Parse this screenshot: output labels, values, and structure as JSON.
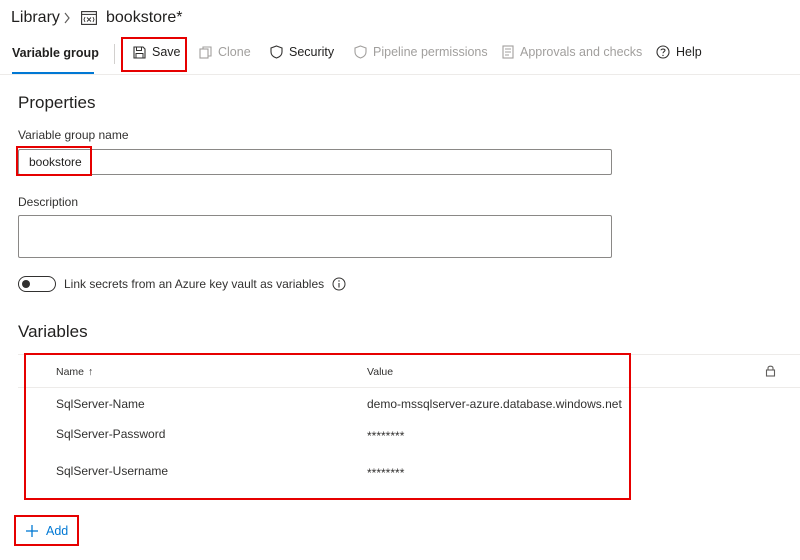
{
  "breadcrumb": {
    "library": "Library",
    "title": "bookstore*"
  },
  "toolbar": {
    "active_tab": "Variable group",
    "save": "Save",
    "clone": "Clone",
    "security": "Security",
    "pipeline_permissions": "Pipeline permissions",
    "approvals_checks": "Approvals and checks",
    "help": "Help"
  },
  "properties": {
    "heading": "Properties",
    "name_label": "Variable group name",
    "name_value": "bookstore",
    "description_label": "Description",
    "description_value": "",
    "link_secrets_label": "Link secrets from an Azure key vault as variables",
    "link_secrets_on": false
  },
  "variables": {
    "heading": "Variables",
    "columns": {
      "name": "Name",
      "name_sort": "↑",
      "value": "Value"
    },
    "rows": [
      {
        "name": "SqlServer-Name",
        "value": "demo-mssqlserver-azure.database.windows.net"
      },
      {
        "name": "SqlServer-Password",
        "value": "********"
      },
      {
        "name": "SqlServer-Username",
        "value": "********"
      }
    ],
    "add_label": "Add"
  },
  "colors": {
    "accent": "#0078d4",
    "annotation": "#e60000",
    "disabled_text": "#a19f9d"
  }
}
